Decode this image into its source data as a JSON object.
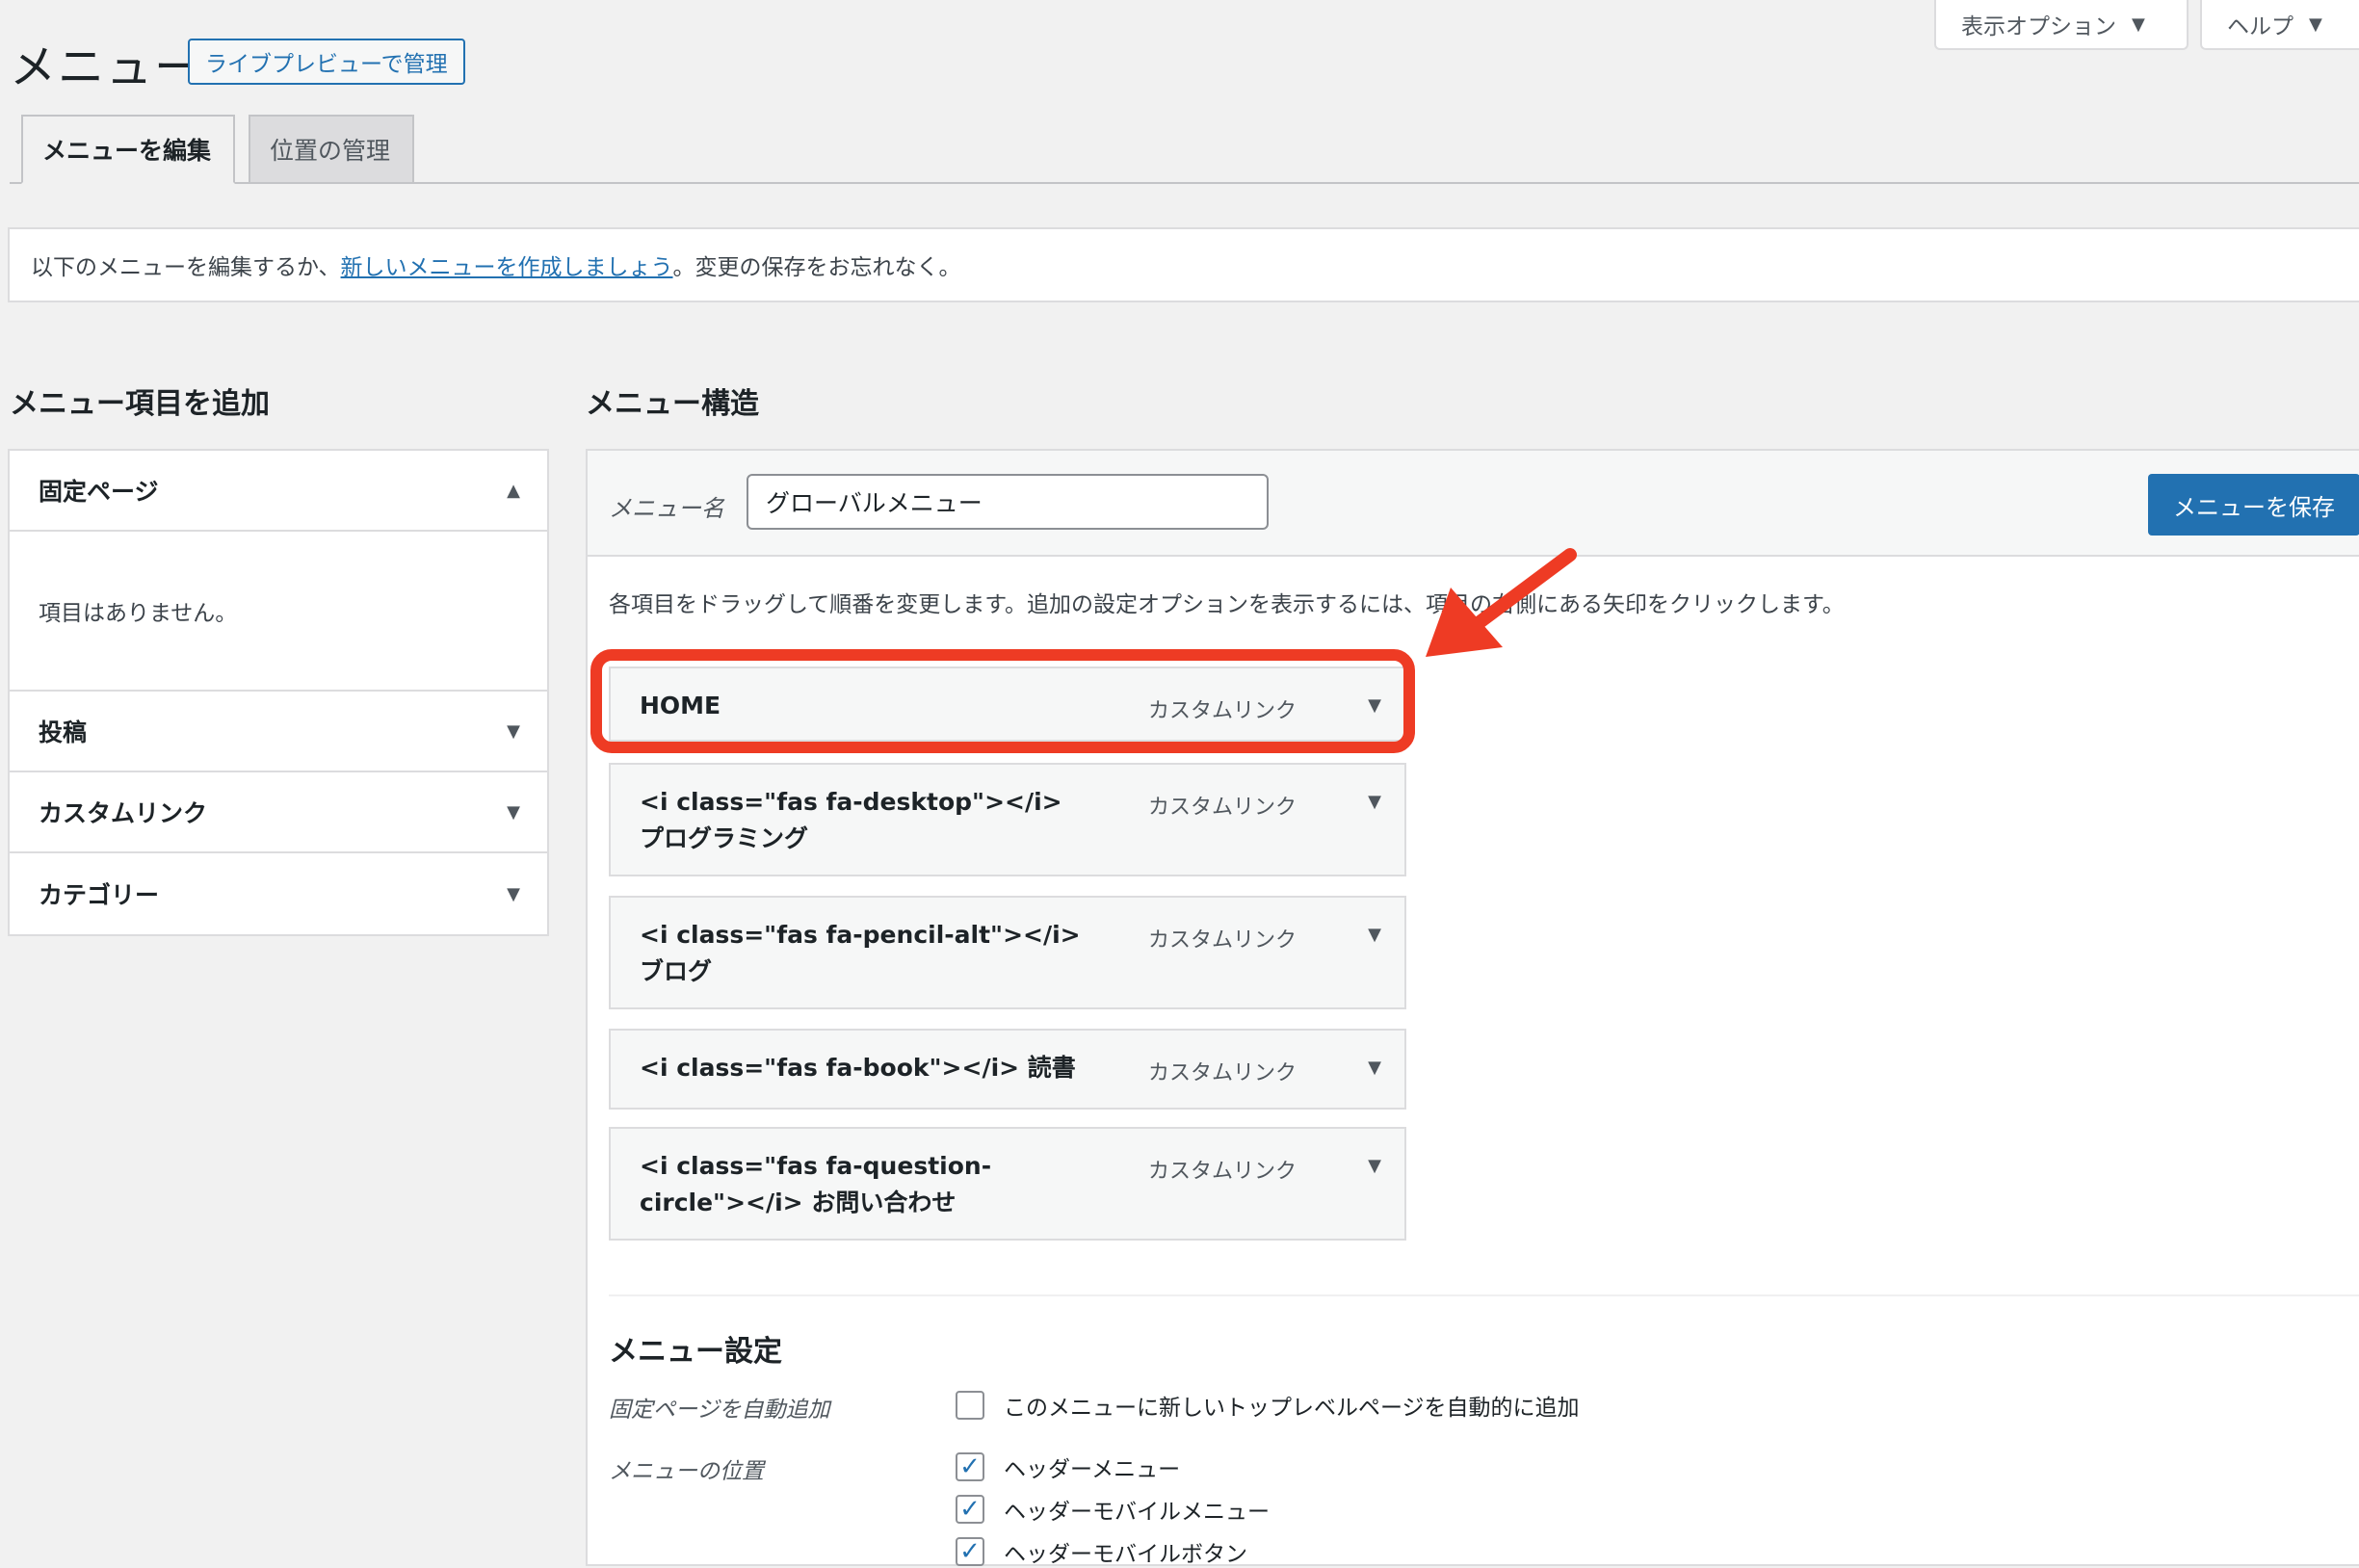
{
  "screen_meta": {
    "display_options_label": "表示オプション",
    "help_label": "ヘルプ"
  },
  "page": {
    "title": "メニュー",
    "live_preview_label": "ライブプレビューで管理"
  },
  "tabs": [
    {
      "label": "メニューを編集",
      "active": true
    },
    {
      "label": "位置の管理",
      "active": false
    }
  ],
  "notice": {
    "before": "以下のメニューを編集するか、",
    "link": "新しいメニューを作成しましょう",
    "after": "。変更の保存をお忘れなく。"
  },
  "add_items": {
    "heading": "メニュー項目を追加",
    "sections": [
      {
        "label": "固定ページ",
        "expanded": true,
        "body": "項目はありません。"
      },
      {
        "label": "投稿",
        "expanded": false
      },
      {
        "label": "カスタムリンク",
        "expanded": false
      },
      {
        "label": "カテゴリー",
        "expanded": false
      }
    ]
  },
  "structure": {
    "heading": "メニュー構造",
    "name_label": "メニュー名",
    "name_value": "グローバルメニュー",
    "save_label": "メニューを保存",
    "instructions": "各項目をドラッグして順番を変更します。追加の設定オプションを表示するには、項目の右側にある矢印をクリックします。",
    "items": [
      {
        "title": "HOME",
        "type": "カスタムリンク"
      },
      {
        "title": "<i class=\"fas fa-desktop\"></i> プログラミング",
        "type": "カスタムリンク"
      },
      {
        "title": "<i class=\"fas fa-pencil-alt\"></i> ブログ",
        "type": "カスタムリンク"
      },
      {
        "title": "<i class=\"fas fa-book\"></i> 読書",
        "type": "カスタムリンク"
      },
      {
        "title": "<i class=\"fas fa-question-circle\"></i> お問い合わせ",
        "type": "カスタムリンク"
      }
    ]
  },
  "settings": {
    "heading": "メニュー設定",
    "auto_add_label": "固定ページを自動追加",
    "auto_add_option": "このメニューに新しいトップレベルページを自動的に追加",
    "location_label": "メニューの位置",
    "locations": [
      {
        "label": "ヘッダーメニュー",
        "checked": true
      },
      {
        "label": "ヘッダーモバイルメニュー",
        "checked": true
      },
      {
        "label": "ヘッダーモバイルボタン",
        "checked": true
      }
    ]
  },
  "colors": {
    "accent": "#2271b1",
    "annotation": "#ee3b24"
  }
}
